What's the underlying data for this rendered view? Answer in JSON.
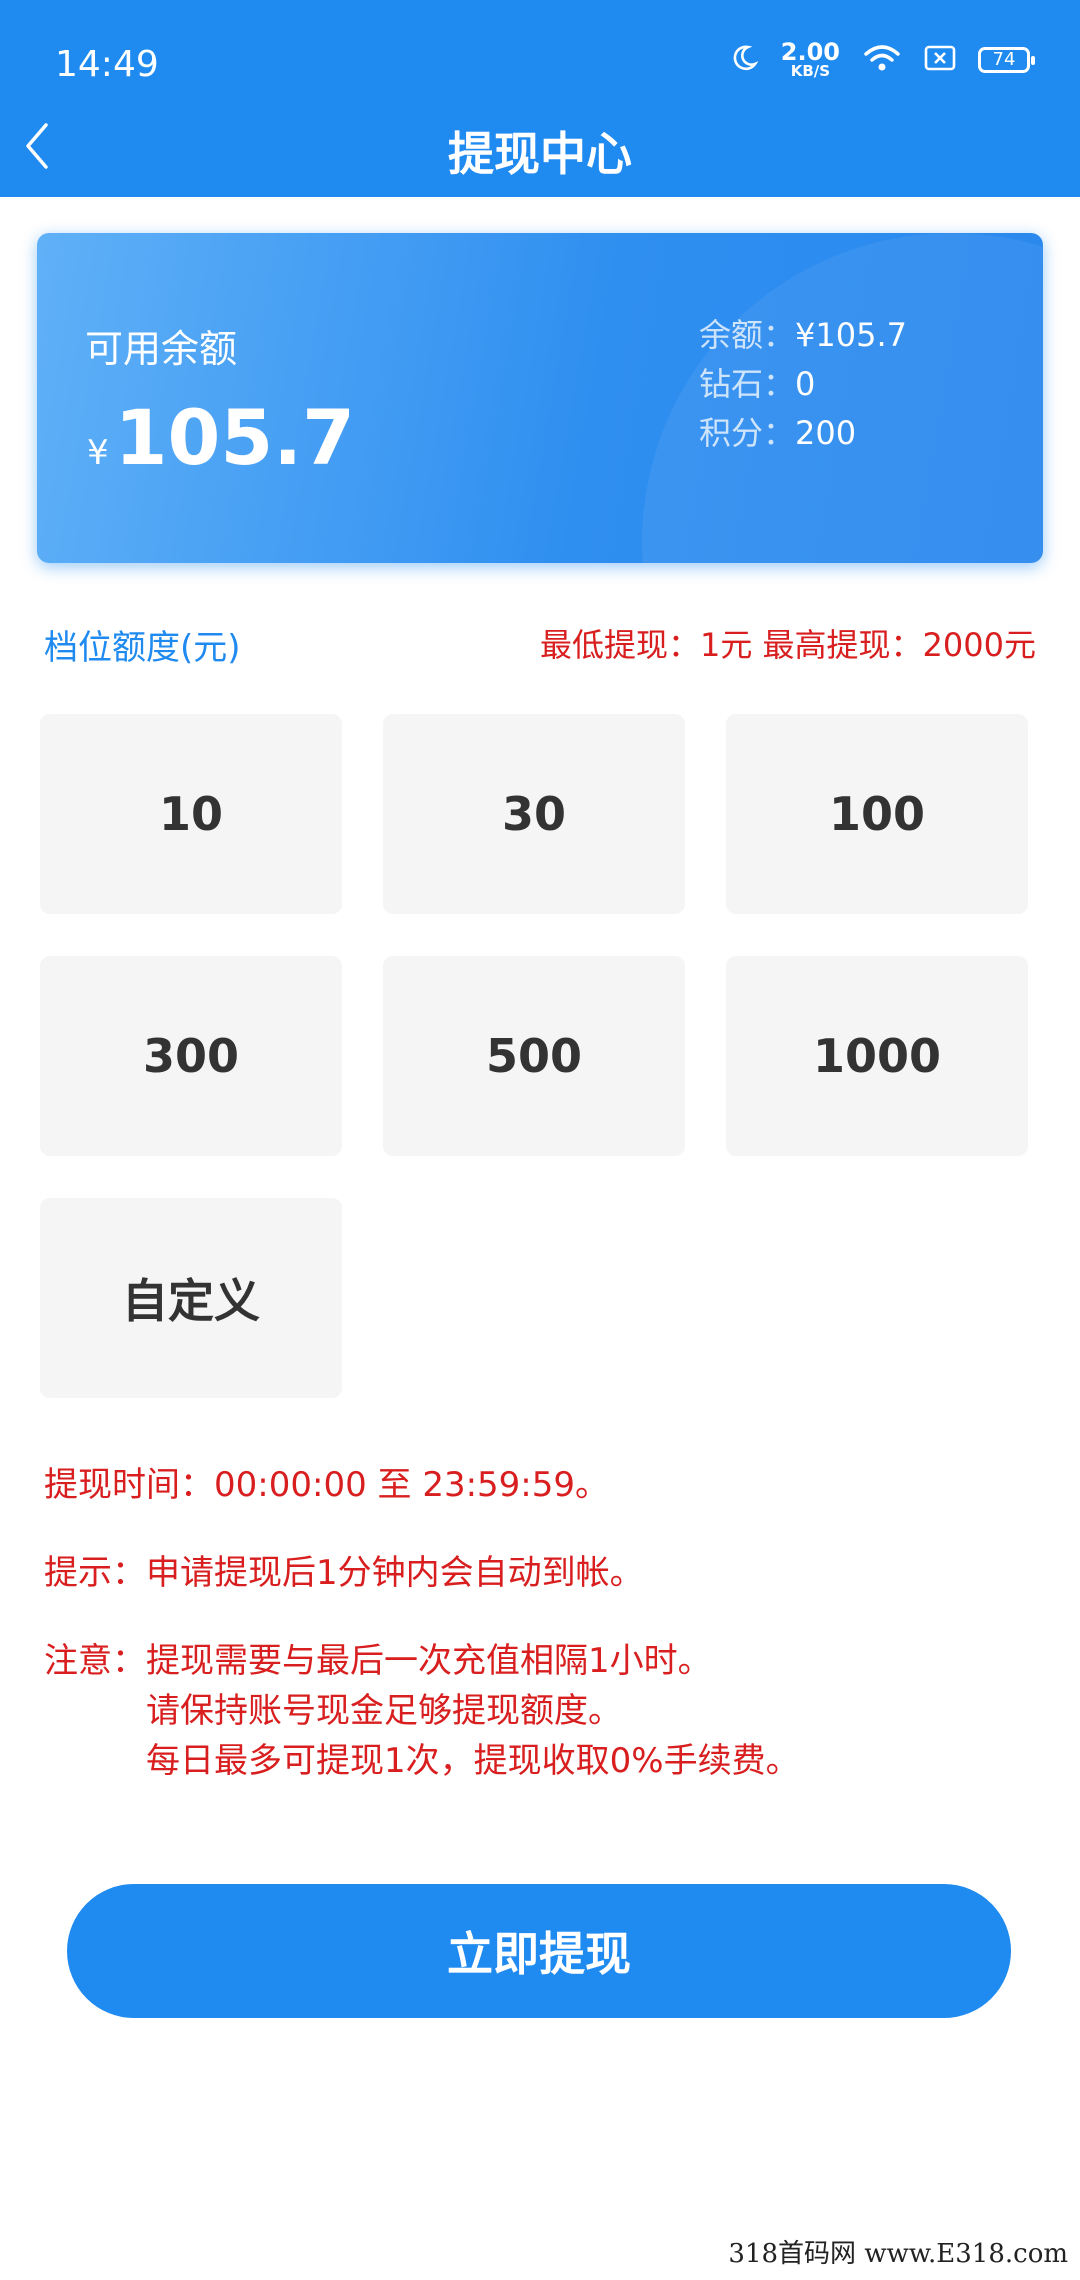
{
  "status_bar": {
    "time": "14:49",
    "speed_value": "2.00",
    "speed_unit": "KB/S",
    "battery": "74"
  },
  "nav": {
    "title": "提现中心",
    "back_icon": "chevron-left-icon"
  },
  "balance_card": {
    "label": "可用余额",
    "currency_symbol": "¥",
    "amount": "105.7",
    "info": [
      {
        "label": "余额：",
        "value": "¥105.7"
      },
      {
        "label": "钻石：",
        "value": "0"
      },
      {
        "label": "积分：",
        "value": "200"
      }
    ]
  },
  "tiers": {
    "heading": "档位额度(元)",
    "limits": "最低提现：1元  最高提现：2000元",
    "options": [
      "10",
      "30",
      "100",
      "300",
      "500",
      "1000",
      "自定义"
    ]
  },
  "notes": {
    "time_label": "提现时间：",
    "time_value": "00:00:00 至 23:59:59。",
    "tip_label": "提示：",
    "tip_value": "申请提现后1分钟内会自动到帐。",
    "warn_label": "注意：",
    "warn_lines": [
      "提现需要与最后一次充值相隔1小时。",
      "请保持账号现金足够提现额度。",
      "每日最多可提现1次，提现收取0%手续费。"
    ]
  },
  "submit_label": "立即提现",
  "watermark": "318首码网 www.E318.com",
  "colors": {
    "primary": "#1f8af0",
    "alert": "#d81e1e",
    "option_bg": "#f5f5f5"
  }
}
